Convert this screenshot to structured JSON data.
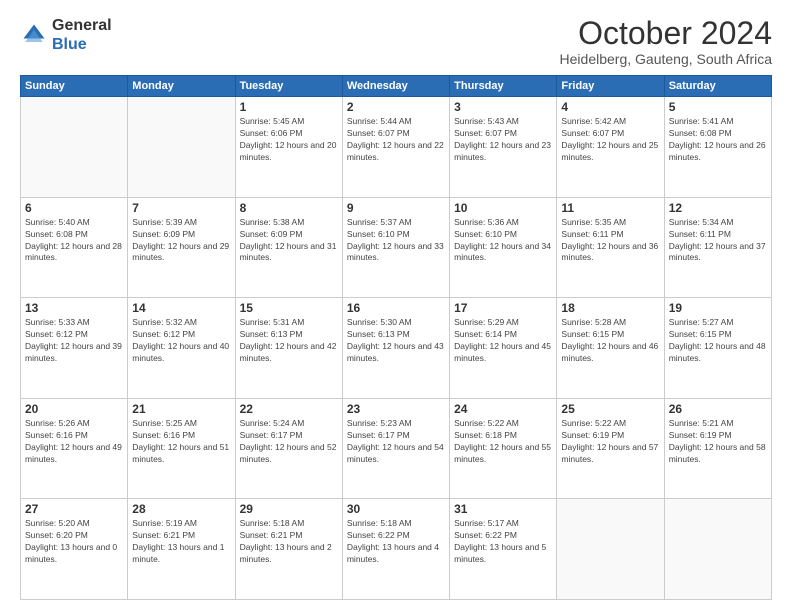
{
  "header": {
    "logo_general": "General",
    "logo_blue": "Blue",
    "month_title": "October 2024",
    "location": "Heidelberg, Gauteng, South Africa"
  },
  "days_of_week": [
    "Sunday",
    "Monday",
    "Tuesday",
    "Wednesday",
    "Thursday",
    "Friday",
    "Saturday"
  ],
  "weeks": [
    [
      {
        "day": "",
        "sunrise": "",
        "sunset": "",
        "daylight": ""
      },
      {
        "day": "",
        "sunrise": "",
        "sunset": "",
        "daylight": ""
      },
      {
        "day": "1",
        "sunrise": "Sunrise: 5:45 AM",
        "sunset": "Sunset: 6:06 PM",
        "daylight": "Daylight: 12 hours and 20 minutes."
      },
      {
        "day": "2",
        "sunrise": "Sunrise: 5:44 AM",
        "sunset": "Sunset: 6:07 PM",
        "daylight": "Daylight: 12 hours and 22 minutes."
      },
      {
        "day": "3",
        "sunrise": "Sunrise: 5:43 AM",
        "sunset": "Sunset: 6:07 PM",
        "daylight": "Daylight: 12 hours and 23 minutes."
      },
      {
        "day": "4",
        "sunrise": "Sunrise: 5:42 AM",
        "sunset": "Sunset: 6:07 PM",
        "daylight": "Daylight: 12 hours and 25 minutes."
      },
      {
        "day": "5",
        "sunrise": "Sunrise: 5:41 AM",
        "sunset": "Sunset: 6:08 PM",
        "daylight": "Daylight: 12 hours and 26 minutes."
      }
    ],
    [
      {
        "day": "6",
        "sunrise": "Sunrise: 5:40 AM",
        "sunset": "Sunset: 6:08 PM",
        "daylight": "Daylight: 12 hours and 28 minutes."
      },
      {
        "day": "7",
        "sunrise": "Sunrise: 5:39 AM",
        "sunset": "Sunset: 6:09 PM",
        "daylight": "Daylight: 12 hours and 29 minutes."
      },
      {
        "day": "8",
        "sunrise": "Sunrise: 5:38 AM",
        "sunset": "Sunset: 6:09 PM",
        "daylight": "Daylight: 12 hours and 31 minutes."
      },
      {
        "day": "9",
        "sunrise": "Sunrise: 5:37 AM",
        "sunset": "Sunset: 6:10 PM",
        "daylight": "Daylight: 12 hours and 33 minutes."
      },
      {
        "day": "10",
        "sunrise": "Sunrise: 5:36 AM",
        "sunset": "Sunset: 6:10 PM",
        "daylight": "Daylight: 12 hours and 34 minutes."
      },
      {
        "day": "11",
        "sunrise": "Sunrise: 5:35 AM",
        "sunset": "Sunset: 6:11 PM",
        "daylight": "Daylight: 12 hours and 36 minutes."
      },
      {
        "day": "12",
        "sunrise": "Sunrise: 5:34 AM",
        "sunset": "Sunset: 6:11 PM",
        "daylight": "Daylight: 12 hours and 37 minutes."
      }
    ],
    [
      {
        "day": "13",
        "sunrise": "Sunrise: 5:33 AM",
        "sunset": "Sunset: 6:12 PM",
        "daylight": "Daylight: 12 hours and 39 minutes."
      },
      {
        "day": "14",
        "sunrise": "Sunrise: 5:32 AM",
        "sunset": "Sunset: 6:12 PM",
        "daylight": "Daylight: 12 hours and 40 minutes."
      },
      {
        "day": "15",
        "sunrise": "Sunrise: 5:31 AM",
        "sunset": "Sunset: 6:13 PM",
        "daylight": "Daylight: 12 hours and 42 minutes."
      },
      {
        "day": "16",
        "sunrise": "Sunrise: 5:30 AM",
        "sunset": "Sunset: 6:13 PM",
        "daylight": "Daylight: 12 hours and 43 minutes."
      },
      {
        "day": "17",
        "sunrise": "Sunrise: 5:29 AM",
        "sunset": "Sunset: 6:14 PM",
        "daylight": "Daylight: 12 hours and 45 minutes."
      },
      {
        "day": "18",
        "sunrise": "Sunrise: 5:28 AM",
        "sunset": "Sunset: 6:15 PM",
        "daylight": "Daylight: 12 hours and 46 minutes."
      },
      {
        "day": "19",
        "sunrise": "Sunrise: 5:27 AM",
        "sunset": "Sunset: 6:15 PM",
        "daylight": "Daylight: 12 hours and 48 minutes."
      }
    ],
    [
      {
        "day": "20",
        "sunrise": "Sunrise: 5:26 AM",
        "sunset": "Sunset: 6:16 PM",
        "daylight": "Daylight: 12 hours and 49 minutes."
      },
      {
        "day": "21",
        "sunrise": "Sunrise: 5:25 AM",
        "sunset": "Sunset: 6:16 PM",
        "daylight": "Daylight: 12 hours and 51 minutes."
      },
      {
        "day": "22",
        "sunrise": "Sunrise: 5:24 AM",
        "sunset": "Sunset: 6:17 PM",
        "daylight": "Daylight: 12 hours and 52 minutes."
      },
      {
        "day": "23",
        "sunrise": "Sunrise: 5:23 AM",
        "sunset": "Sunset: 6:17 PM",
        "daylight": "Daylight: 12 hours and 54 minutes."
      },
      {
        "day": "24",
        "sunrise": "Sunrise: 5:22 AM",
        "sunset": "Sunset: 6:18 PM",
        "daylight": "Daylight: 12 hours and 55 minutes."
      },
      {
        "day": "25",
        "sunrise": "Sunrise: 5:22 AM",
        "sunset": "Sunset: 6:19 PM",
        "daylight": "Daylight: 12 hours and 57 minutes."
      },
      {
        "day": "26",
        "sunrise": "Sunrise: 5:21 AM",
        "sunset": "Sunset: 6:19 PM",
        "daylight": "Daylight: 12 hours and 58 minutes."
      }
    ],
    [
      {
        "day": "27",
        "sunrise": "Sunrise: 5:20 AM",
        "sunset": "Sunset: 6:20 PM",
        "daylight": "Daylight: 13 hours and 0 minutes."
      },
      {
        "day": "28",
        "sunrise": "Sunrise: 5:19 AM",
        "sunset": "Sunset: 6:21 PM",
        "daylight": "Daylight: 13 hours and 1 minute."
      },
      {
        "day": "29",
        "sunrise": "Sunrise: 5:18 AM",
        "sunset": "Sunset: 6:21 PM",
        "daylight": "Daylight: 13 hours and 2 minutes."
      },
      {
        "day": "30",
        "sunrise": "Sunrise: 5:18 AM",
        "sunset": "Sunset: 6:22 PM",
        "daylight": "Daylight: 13 hours and 4 minutes."
      },
      {
        "day": "31",
        "sunrise": "Sunrise: 5:17 AM",
        "sunset": "Sunset: 6:22 PM",
        "daylight": "Daylight: 13 hours and 5 minutes."
      },
      {
        "day": "",
        "sunrise": "",
        "sunset": "",
        "daylight": ""
      },
      {
        "day": "",
        "sunrise": "",
        "sunset": "",
        "daylight": ""
      }
    ]
  ]
}
